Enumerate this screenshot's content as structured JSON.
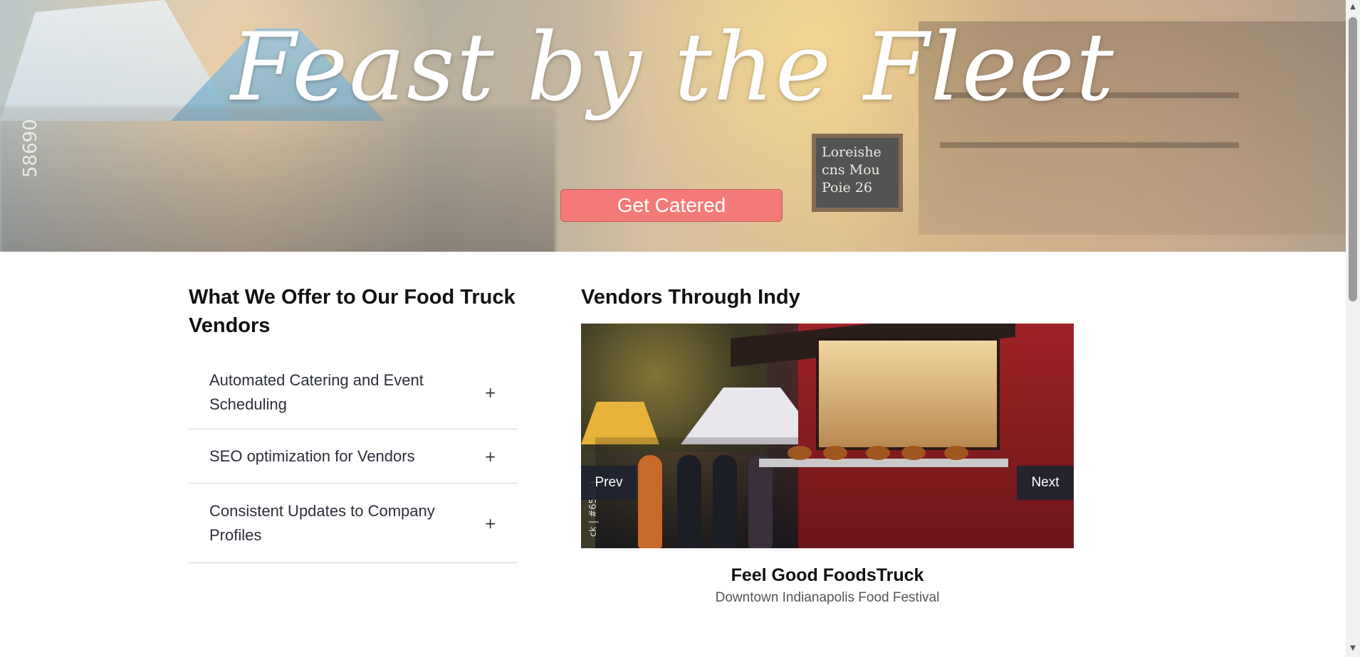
{
  "hero": {
    "title": "Feast by the Fleet",
    "cta_label": "Get Catered",
    "image_watermark": "58690",
    "chalkboard_text": [
      "Loreishe",
      "cns Mou",
      "Poie 26"
    ]
  },
  "offer": {
    "heading": "What We Offer to Our Food Truck Vendors",
    "items": [
      {
        "label": "Automated Catering and Event Scheduling",
        "icon": "+"
      },
      {
        "label": "SEO optimization for Vendors",
        "icon": "+"
      },
      {
        "label": "Consistent Updates to Company Profiles",
        "icon": "+"
      }
    ]
  },
  "vendors": {
    "heading": "Vendors Through Indy",
    "carousel": {
      "prev_label": "Prev",
      "next_label": "Next",
      "image_watermark": "ck | #65624"
    },
    "caption": {
      "title": "Feel Good FoodsTruck",
      "subtitle": "Downtown Indianapolis Food Festival"
    }
  },
  "colors": {
    "cta": "#f47a78",
    "carousel_buttons": "#1e2430"
  },
  "icons": [
    "plus-icon",
    "scroll-up-arrow",
    "scroll-down-arrow"
  ]
}
